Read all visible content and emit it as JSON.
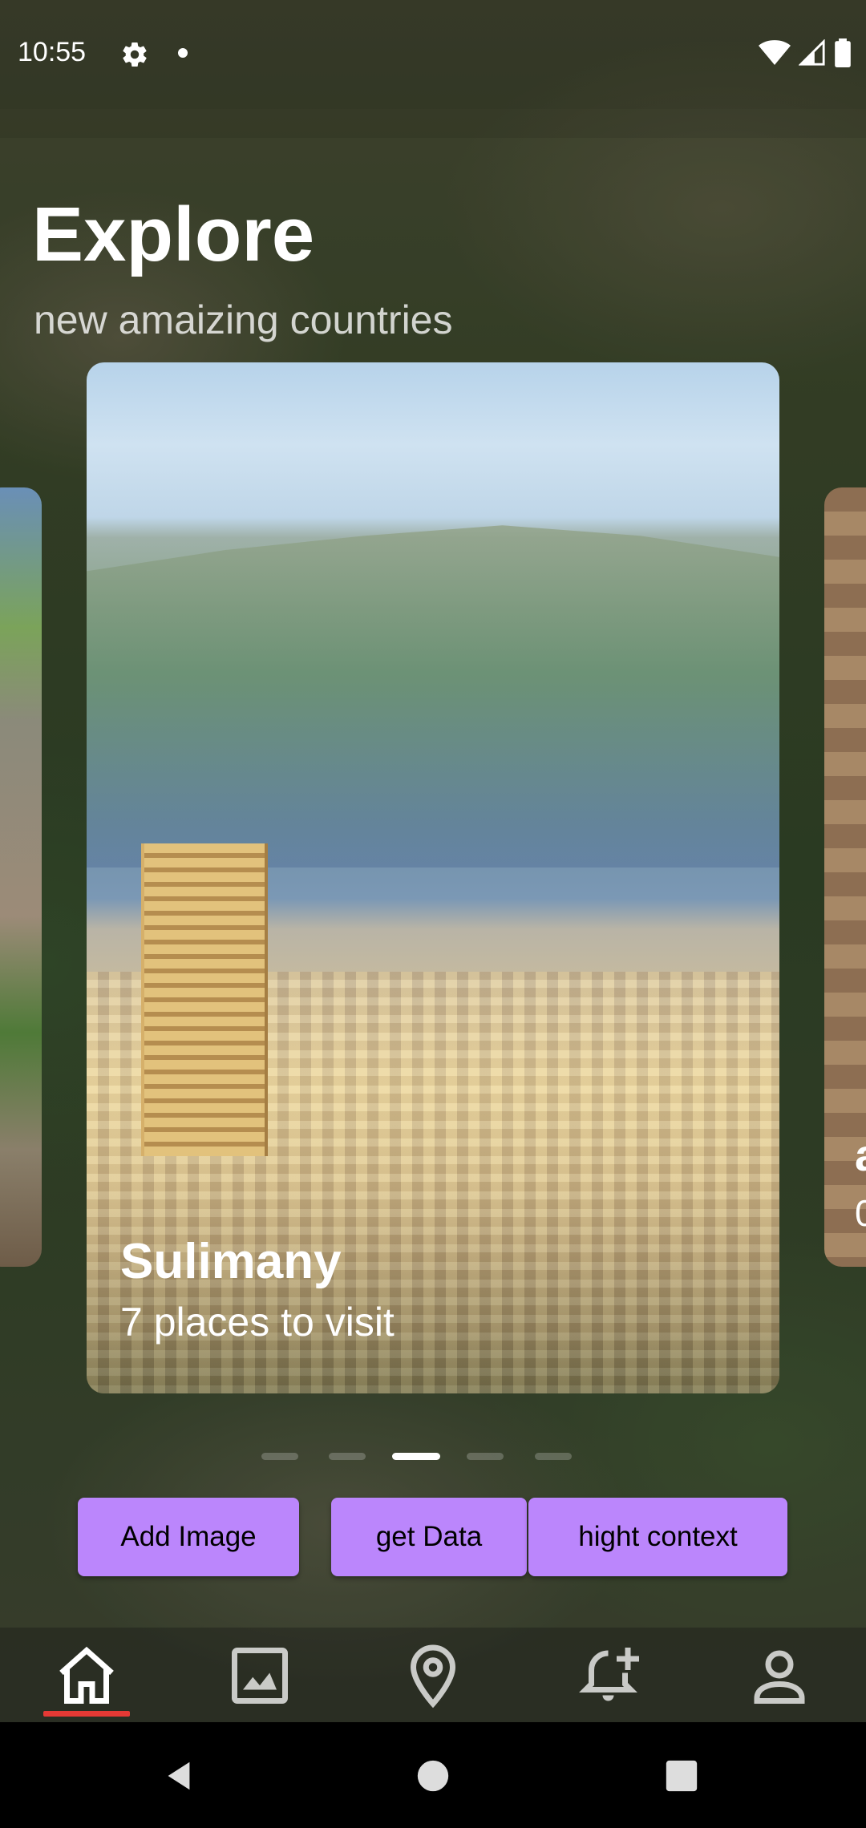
{
  "status_bar": {
    "time": "10:55",
    "icons": [
      "gear-icon",
      "notification-dot",
      "wifi-icon",
      "signal-icon",
      "battery-icon"
    ]
  },
  "header": {
    "title": "Explore",
    "subtitle": "new amaizing countries"
  },
  "carousel": {
    "cards": [
      {
        "title": "Sulimany",
        "subtitle": "7 places to visit",
        "state": "active"
      },
      {
        "title": "a",
        "subtitle": "0",
        "state": "next-peek"
      }
    ],
    "page_count": 5,
    "active_page": 3
  },
  "buttons": {
    "add_image": "Add Image",
    "get_data": "get Data",
    "hight_context": "hight context"
  },
  "bottom_nav": {
    "items": [
      "home-icon",
      "image-icon",
      "location-icon",
      "add-alert-icon",
      "person-icon"
    ],
    "selected": "home-icon"
  },
  "colors": {
    "accent": "#bb86fc",
    "nav_indicator": "#e53935"
  }
}
